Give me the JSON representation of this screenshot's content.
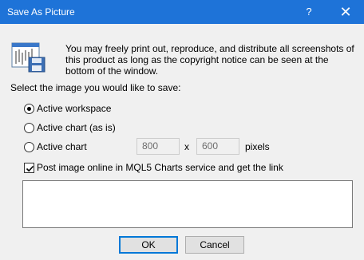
{
  "window": {
    "title": "Save As Picture",
    "help_glyph": "?",
    "close_glyph": "✕"
  },
  "header": {
    "icon": "image-save-icon",
    "notice": "You may freely print out, reproduce, and distribute all screenshots of this product as long as the copyright notice can be seen at the bottom of the window."
  },
  "prompt": "Select the image you would like to save:",
  "options": {
    "active_workspace": {
      "label": "Active workspace",
      "selected": true
    },
    "active_chart_as_is": {
      "label": "Active chart (as is)",
      "selected": false
    },
    "active_chart": {
      "label": "Active chart",
      "selected": false
    }
  },
  "size": {
    "width": "800",
    "by": "x",
    "height": "600",
    "unit": "pixels"
  },
  "publish": {
    "label": "Post image online in MQL5 Charts service and get the link",
    "checked": true,
    "link_value": ""
  },
  "buttons": {
    "ok": "OK",
    "cancel": "Cancel"
  },
  "colors": {
    "titlebar": "#1e73d8",
    "default_button_border": "#0078d7"
  }
}
